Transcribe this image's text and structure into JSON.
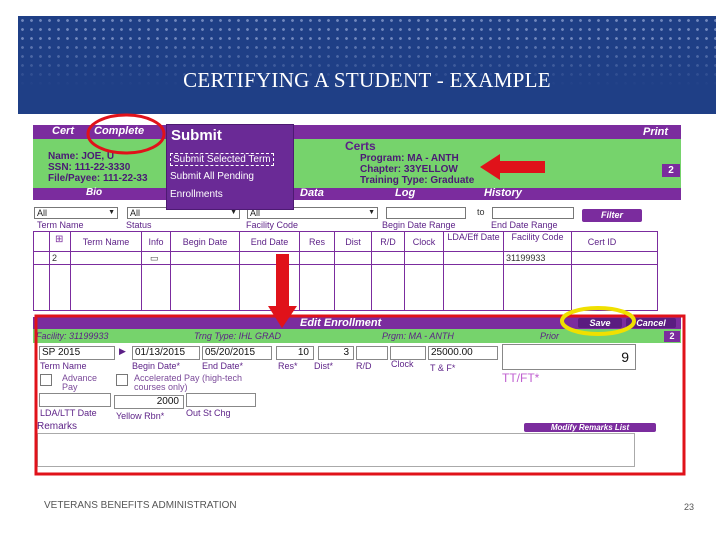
{
  "slide": {
    "title": "CERTIFYING A STUDENT - EXAMPLE",
    "footer": "VETERANS BENEFITS ADMINISTRATION",
    "page_number": "23"
  },
  "top_tabs": {
    "cert": "Cert",
    "complete": "Complete",
    "print": "Print"
  },
  "submit_menu": {
    "header": "Submit",
    "items": [
      "Submit Selected Term",
      "Submit All Pending",
      "Enrollments"
    ]
  },
  "certs": {
    "header": "Certs",
    "name": "Name: JOE, U",
    "ssn": "SSN: 111-22-3330",
    "payee": "File/Payee: 111-22-33",
    "program": "Program: MA - ANTH",
    "chapter": "Chapter: 33YELLOW",
    "training_type": "Training Type: Graduate",
    "count_badge": "2"
  },
  "nav_tabs": {
    "bio": "Bio",
    "data": "Data",
    "log": "Log",
    "history": "History"
  },
  "filters": {
    "dropdowns": [
      "All",
      "All",
      "All"
    ],
    "term_label": "Term Name",
    "status_label": "Status",
    "facility_label": "Facility Code",
    "begin_range_label": "Begin Date Range",
    "to_label": "to",
    "end_range_label": "End Date Range",
    "filter_button": "Filter"
  },
  "table": {
    "headers": [
      "Term Name",
      "Info",
      "Begin Date",
      "End Date",
      "Res",
      "Dist",
      "R/D",
      "Clock",
      "LDA/Eff Date",
      "Facility Code",
      "Cert ID"
    ],
    "row": {
      "count": "2",
      "facility": "31199933"
    }
  },
  "edit": {
    "header": "Edit Enrollment",
    "facility": "Facility: 31199933",
    "trng_type": "Trng Type: IHL GRAD",
    "prgm": "Prgm: MA - ANTH",
    "prior_label": "Prior",
    "save": "Save",
    "cancel": "Cancel",
    "count_badge": "2",
    "term_value": "SP 2015",
    "begin_value": "01/13/2015",
    "end_value": "05/20/2015",
    "res_value": "10",
    "dist_value": "3",
    "tuition_value": "25000.00",
    "ttft_value": "9",
    "labels": {
      "term": "Term Name",
      "begin": "Begin Date*",
      "end": "End Date*",
      "res": "Res*",
      "dist": "Dist*",
      "rd": "R/D",
      "clock": "Clock",
      "tf": "T & F*",
      "ttft": "TT/FT*"
    },
    "advance_pay": "Advance Pay",
    "accelerated_pay": "Accelerated Pay (high-tech courses only)",
    "yellow_rbn_value": "2000",
    "lda_label": "LDA/LTT Date",
    "yellow_rbn_label": "Yellow Rbn*",
    "out_st_label": "Out St Chg",
    "remarks_label": "Remarks",
    "modify_remarks": "Modify Remarks List"
  },
  "colors": {
    "purple": "#7b2c9e",
    "green": "#76d36c",
    "banner": "#1f3f86",
    "highlight_red": "#e0121a",
    "highlight_yellow": "#f0e000"
  }
}
